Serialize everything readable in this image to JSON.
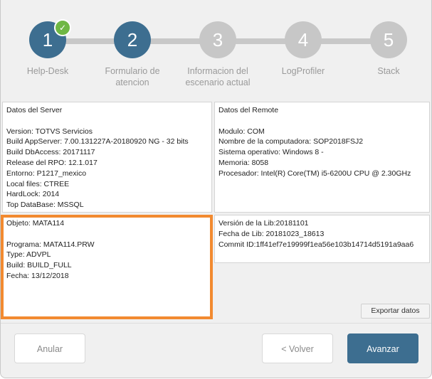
{
  "steps": [
    {
      "number": "1",
      "label": "Help-Desk",
      "state": "completed"
    },
    {
      "number": "2",
      "label_lines": [
        "Formulario de",
        "atencion"
      ],
      "state": "active"
    },
    {
      "number": "3",
      "label_lines": [
        "Informacion del",
        "escenario actual"
      ],
      "state": "inactive"
    },
    {
      "number": "4",
      "label": "LogProfiler",
      "state": "inactive"
    },
    {
      "number": "5",
      "label": "Stack",
      "state": "inactive"
    }
  ],
  "server": {
    "title": "Datos del Server",
    "lines": [
      "Version: TOTVS Servicios",
      "Build AppServer: 7.00.131227A-20180920 NG - 32 bits",
      "Build DbAccess: 20171117",
      "Release del RPO:  12.1.017",
      "Entorno: P1217_mexico",
      "Local files: CTREE",
      "HardLock: 2014",
      "Top DataBase: MSSQL"
    ]
  },
  "remote": {
    "title": "Datos del Remote",
    "lines": [
      "Modulo: COM",
      "Nombre de la computadora: SOP2018FSJ2",
      "Sistema operativo: Windows 8 -",
      "Memoria: 8058",
      "Procesador: Intel(R) Core(TM) i5-6200U CPU @ 2.30GHz"
    ]
  },
  "object": {
    "title": "Objeto: MATA114",
    "lines": [
      "Programa: MATA114.PRW",
      "Type: ADVPL",
      "Build: BUILD_FULL",
      "Fecha: 13/12/2018"
    ]
  },
  "lib": {
    "lines": [
      "Versión de la Lib:20181101",
      "Fecha de Lib: 20181023_18613",
      "Commit ID:1ff41ef7e19999f1ea56e103b14714d5191a9aa6"
    ]
  },
  "buttons": {
    "export": "Exportar datos",
    "cancel": "Anular",
    "back": "< Volver",
    "next": "Avanzar"
  },
  "colors": {
    "accent": "#3d6e90",
    "highlight": "#f28a30",
    "success": "#6fb744"
  }
}
